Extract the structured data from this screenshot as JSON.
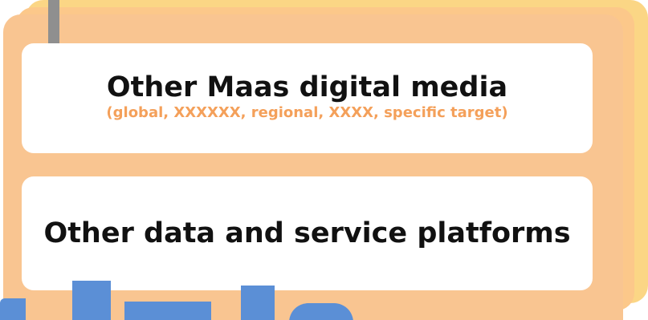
{
  "panels": [
    {
      "title": "Other Maas digital media",
      "subtitle": "(global, XXXXXX, regional, XXXX, specific target)"
    },
    {
      "title": "Other data and service platforms"
    }
  ],
  "colors": {
    "back_card": "#fbd685",
    "middle_card": "#fcc88a",
    "front_card": "#f9c591",
    "panel_background": "#ffffff",
    "title_text": "#111111",
    "subtitle_text": "#f4a05a",
    "connector": "#8f8f8f",
    "cropped_logo": "#5b8fd6"
  }
}
